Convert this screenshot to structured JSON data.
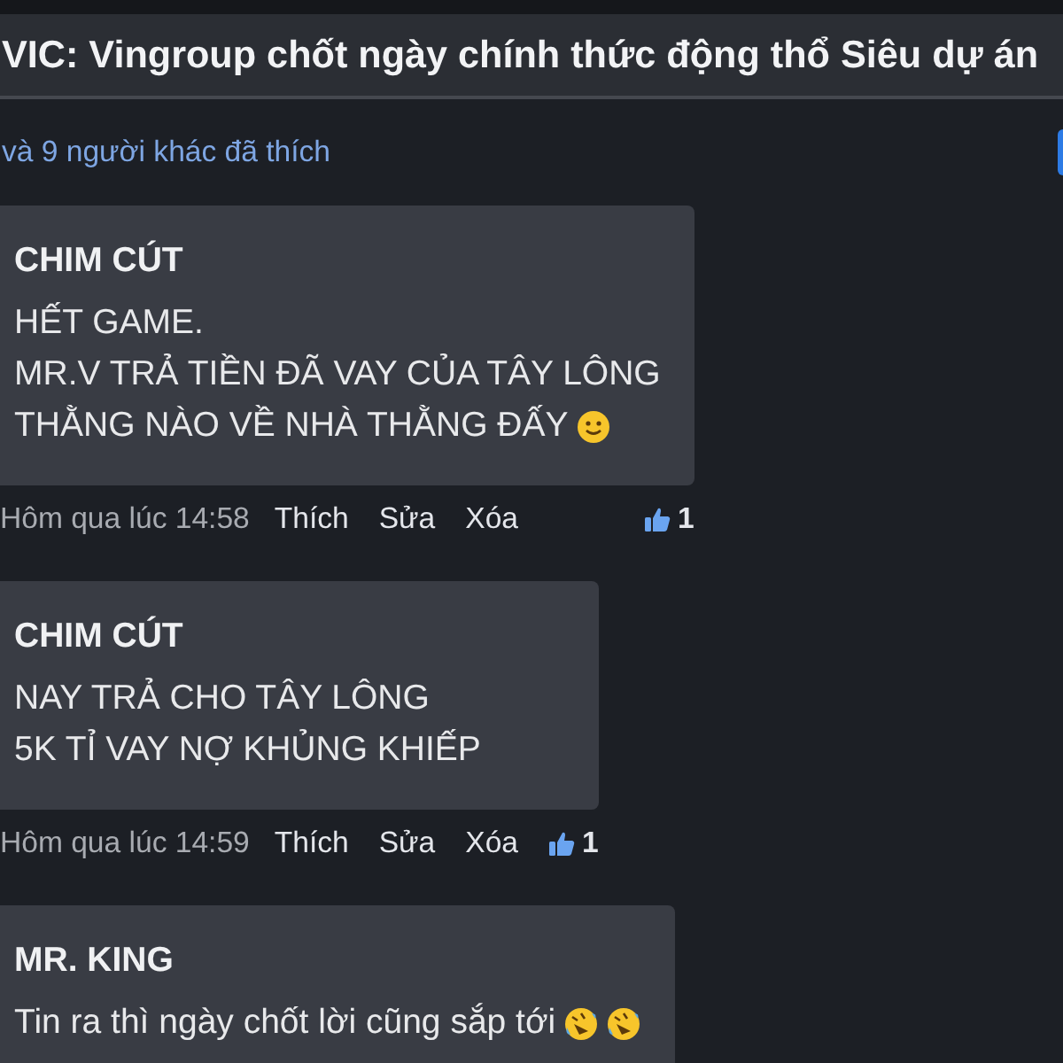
{
  "title": "VIC: Vingroup chốt ngày chính thức động thổ Siêu dự án",
  "likes_summary": "và 9 người khác đã thích",
  "comments": [
    {
      "author": "CHIM CÚT",
      "lines": [
        {
          "text": "HẾT GAME."
        },
        {
          "text": "MR.V TRẢ TIỀN ĐÃ VAY CỦA TÂY LÔNG"
        },
        {
          "text": "THẰNG NÀO VỀ NHÀ THẰNG ĐẤY",
          "emoji": [
            {
              "kind": "smile"
            }
          ]
        }
      ],
      "time": "Hôm qua lúc 14:58",
      "actions": [
        "Thích",
        "Sửa",
        "Xóa"
      ],
      "like_count": "1"
    },
    {
      "author": "CHIM CÚT",
      "lines": [
        {
          "text": "NAY TRẢ CHO TÂY LÔNG"
        },
        {
          "text": "5K TỈ VAY NỢ KHỦNG KHIẾP"
        }
      ],
      "time": "Hôm qua lúc 14:59",
      "actions": [
        "Thích",
        "Sửa",
        "Xóa"
      ],
      "like_count": "1"
    },
    {
      "author": "MR. KING",
      "lines": [
        {
          "text": "Tin ra thì ngày chốt lời cũng sắp tới",
          "emoji": [
            {
              "kind": "laugh"
            },
            {
              "kind": "laugh"
            }
          ]
        }
      ]
    }
  ]
}
